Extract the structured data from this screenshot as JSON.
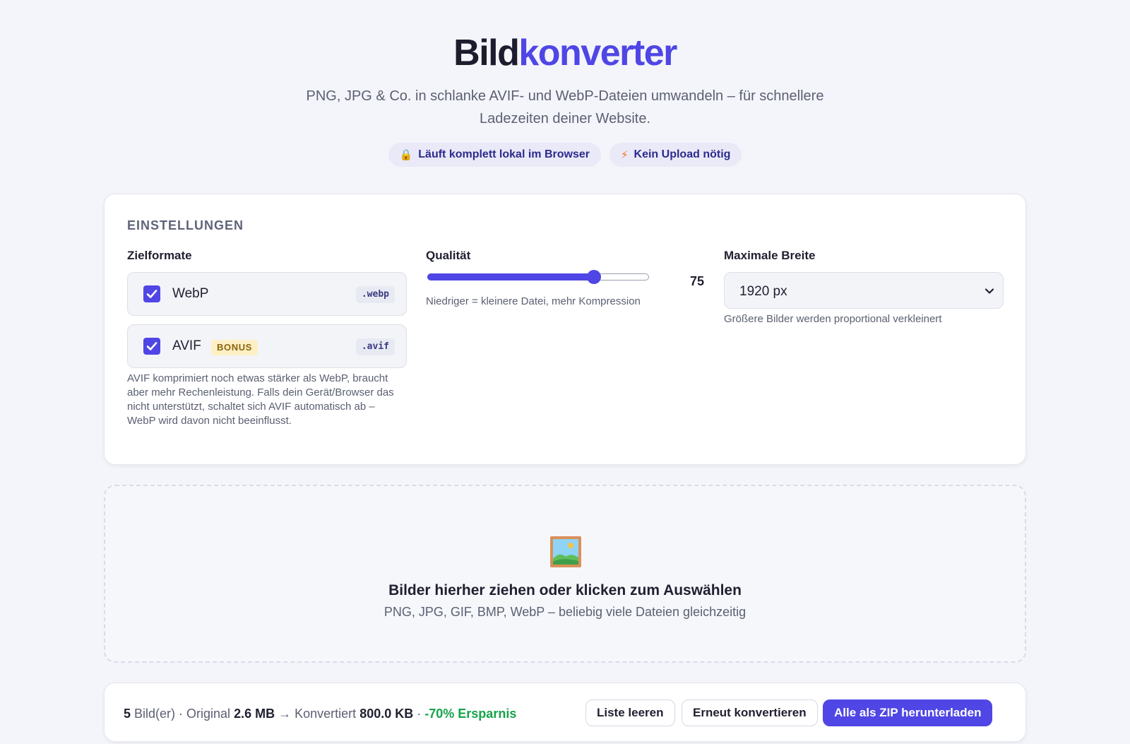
{
  "header": {
    "title_part1": "Bild",
    "title_part2": "konverter",
    "subtitle": "PNG, JPG & Co. in schlanke AVIF- und WebP-Dateien umwandeln – für schnellere Ladezeiten deiner Website.",
    "pills": [
      {
        "icon": "lock-icon",
        "glyph": "🔒",
        "label": "Läuft komplett lokal im Browser"
      },
      {
        "icon": "lightning-icon",
        "glyph": "⚡",
        "label": "Kein Upload nötig"
      }
    ]
  },
  "settings": {
    "section_title": "EINSTELLUNGEN",
    "formats": {
      "label": "Zielformate",
      "webp": {
        "name": "WebP",
        "ext": ".webp",
        "checked": true
      },
      "avif": {
        "name": "AVIF",
        "badge": "BONUS",
        "ext": ".avif",
        "checked": true
      },
      "note": "AVIF komprimiert noch etwas stärker als WebP, braucht aber mehr Rechenleistung. Falls dein Gerät/Browser das nicht unterstützt, schaltet sich AVIF automatisch ab – WebP wird davon nicht beeinflusst."
    },
    "quality": {
      "label": "Qualität",
      "value": "75",
      "min": 0,
      "max": 100,
      "hint": "Niedriger = kleinere Datei, mehr Kompression"
    },
    "max_width": {
      "label": "Maximale Breite",
      "selected": "1920 px",
      "hint": "Größere Bilder werden proportional verkleinert"
    }
  },
  "dropzone": {
    "icon": "image-icon",
    "title": "Bilder hierher ziehen oder klicken zum Auswählen",
    "subtitle": "PNG, JPG, GIF, BMP, WebP – beliebig viele Dateien gleichzeitig"
  },
  "summary": {
    "count": "5",
    "count_suffix": "Bild(er) · Original",
    "original_size": "2.6 MB",
    "arrow_text": "→ Konvertiert",
    "converted_size": "800.0 KB",
    "separator": "·",
    "saving": "-70% Ersparnis"
  },
  "actions": {
    "clear": "Liste leeren",
    "reconvert": "Erneut konvertieren",
    "download_zip": "Alle als ZIP herunterladen"
  },
  "colors": {
    "accent": "#4f46e5",
    "success": "#16a34a",
    "background": "#f4f5fa"
  }
}
